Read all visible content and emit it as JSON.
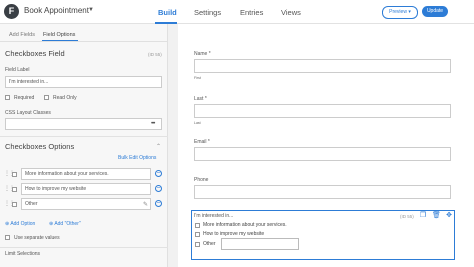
{
  "header": {
    "form_title": "Book Appointment",
    "nav": [
      "Build",
      "Settings",
      "Entries",
      "Views"
    ],
    "preview_label": "Preview",
    "update_label": "Update"
  },
  "sidebar": {
    "tabs": [
      "Add Fields",
      "Field Options"
    ],
    "section_title": "Checkboxes Field",
    "field_id": "(ID 55)",
    "field_label_caption": "Field Label",
    "field_label_value": "I'm interested in...",
    "required_label": "Required",
    "read_only_label": "Read Only",
    "css_classes_label": "CSS Layout Classes",
    "options_title": "Checkboxes Options",
    "bulk_edit_label": "Bulk Edit Options",
    "options": [
      "More information about your services.",
      "How to improve my website",
      "Other"
    ],
    "add_option_label": "Add Option",
    "add_other_label": "Add \"Other\"",
    "separate_values_label": "Use separate values",
    "limit_selections_label": "Limit Selections"
  },
  "canvas": {
    "name_label": "Name *",
    "first_caption": "First",
    "last_label": "Last *",
    "last_caption": "Last",
    "email_label": "Email *",
    "phone_label": "Phone",
    "selected_field": {
      "title": "I'm interested in...",
      "id": "(ID 55)",
      "options": [
        "More information about your services.",
        "How to improve my website",
        "Other"
      ]
    }
  }
}
